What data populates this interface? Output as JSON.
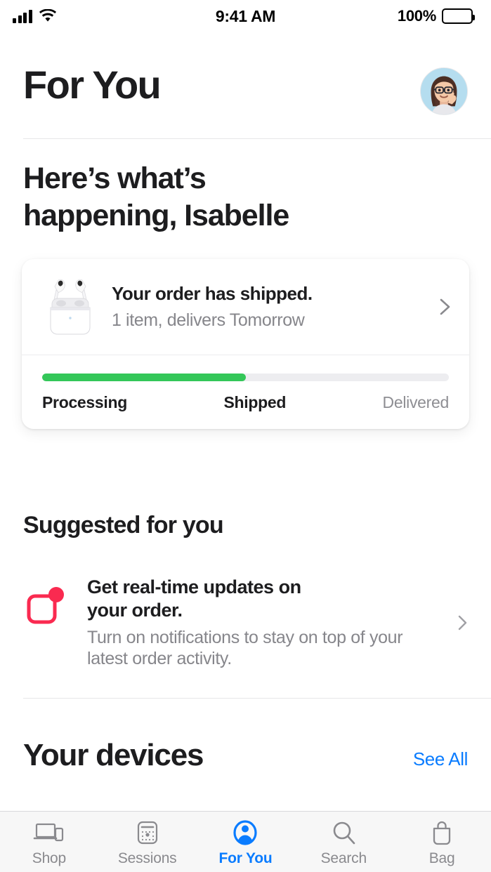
{
  "status_bar": {
    "signal_icon": "cellular-signal-icon",
    "wifi_icon": "wifi-icon",
    "time": "9:41 AM",
    "battery_percent": "100%",
    "battery_icon": "battery-full-icon"
  },
  "header": {
    "title": "For You",
    "avatar_name": "memoji-avatar",
    "greeting_line1": "Here’s what’s",
    "greeting_line2": "happening, Isabelle"
  },
  "order_card": {
    "product_icon": "airpods-pro-icon",
    "title": "Your order has shipped.",
    "subtitle": "1 item, delivers Tomorrow",
    "chevron_icon": "chevron-right-icon",
    "progress_percent": 50,
    "progress_color": "#34C759",
    "track_color": "#EDEDF0",
    "steps": [
      {
        "label": "Processing",
        "complete": true
      },
      {
        "label": "Shipped",
        "complete": true
      },
      {
        "label": "Delivered",
        "complete": false
      }
    ]
  },
  "suggested": {
    "section_title": "Suggested for you",
    "item": {
      "icon": "notification-badge-icon",
      "icon_color": "#FA2A50",
      "title_line1": "Get real-time updates on",
      "title_line2": "your order.",
      "body_line1": "Turn on notifications to stay on top of your",
      "body_line2": "latest order activity.",
      "chevron_icon": "chevron-right-icon"
    }
  },
  "devices": {
    "section_title": "Your devices",
    "see_all_label": "See All",
    "accent_color": "#0A7CFF"
  },
  "tab_bar": {
    "active_color": "#0A7CFF",
    "inactive_color": "#8A8A8E",
    "tabs": [
      {
        "label": "Shop",
        "icon": "laptop-phone-icon",
        "active": false
      },
      {
        "label": "Sessions",
        "icon": "sessions-calendar-icon",
        "active": false
      },
      {
        "label": "For You",
        "icon": "person-circle-icon",
        "active": true
      },
      {
        "label": "Search",
        "icon": "magnifier-icon",
        "active": false
      },
      {
        "label": "Bag",
        "icon": "shopping-bag-icon",
        "active": false
      }
    ]
  }
}
